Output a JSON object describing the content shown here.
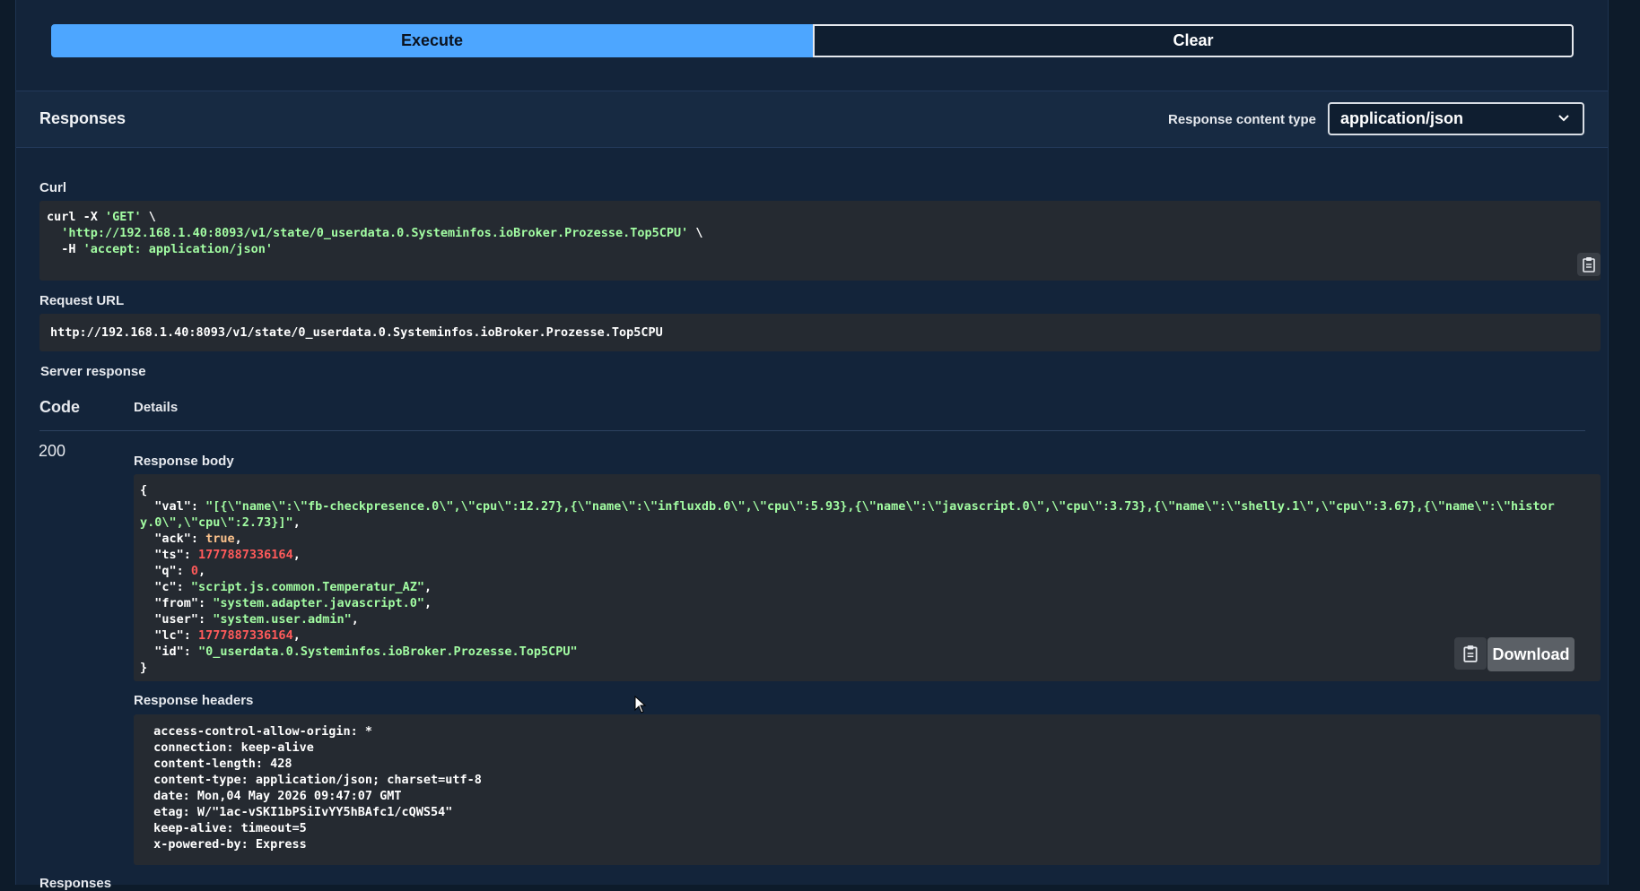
{
  "buttons": {
    "execute": "Execute",
    "clear": "Clear"
  },
  "responses_header": {
    "title": "Responses",
    "content_type_label": "Response content type",
    "content_type_value": "application/json"
  },
  "curl": {
    "label": "Curl",
    "line1_cmd": "curl -X ",
    "line1_method": "'GET'",
    "line1_end": " \\",
    "line2_indent": "  ",
    "line2_url": "'http://192.168.1.40:8093/v1/state/0_userdata.0.Systeminfos.ioBroker.Prozesse.Top5CPU'",
    "line2_end": " \\",
    "line3_flag": "  -H ",
    "line3_header": "'accept: application/json'"
  },
  "request_url": {
    "label": "Request URL",
    "value": "http://192.168.1.40:8093/v1/state/0_userdata.0.Systeminfos.ioBroker.Prozesse.Top5CPU"
  },
  "server_response": {
    "label": "Server response",
    "col_code": "Code",
    "col_details": "Details",
    "code": "200"
  },
  "response_body": {
    "label": "Response body",
    "open": "{",
    "close": "}",
    "lines": [
      {
        "key": "  \"val\": ",
        "value": "\"[{\\\"name\\\":\\\"fb-checkpresence.0\\\",\\\"cpu\\\":12.27},{\\\"name\\\":\\\"influxdb.0\\\",\\\"cpu\\\":5.93},{\\\"name\\\":\\\"javascript.0\\\",\\\"cpu\\\":3.73},{\\\"name\\\":\\\"shelly.1\\\",\\\"cpu\\\":3.67},{\\\"name\\\":\\\"histor",
        "type": "str",
        "end": ""
      },
      {
        "key": "",
        "value": "y.0\\\",\\\"cpu\\\":2.73}]\"",
        "type": "str",
        "end": ","
      },
      {
        "key": "  \"ack\": ",
        "value": "true",
        "type": "bool",
        "end": ","
      },
      {
        "key": "  \"ts\": ",
        "value": "1777887336164",
        "type": "num",
        "end": ","
      },
      {
        "key": "  \"q\": ",
        "value": "0",
        "type": "num",
        "end": ","
      },
      {
        "key": "  \"c\": ",
        "value": "\"script.js.common.Temperatur_AZ\"",
        "type": "str",
        "end": ","
      },
      {
        "key": "  \"from\": ",
        "value": "\"system.adapter.javascript.0\"",
        "type": "str",
        "end": ","
      },
      {
        "key": "  \"user\": ",
        "value": "\"system.user.admin\"",
        "type": "str",
        "end": ","
      },
      {
        "key": "  \"lc\": ",
        "value": "1777887336164",
        "type": "num",
        "end": ","
      },
      {
        "key": "  \"id\": ",
        "value": "\"0_userdata.0.Systeminfos.ioBroker.Prozesse.Top5CPU\"",
        "type": "str",
        "end": ""
      }
    ],
    "download_label": "Download"
  },
  "response_headers": {
    "label": "Response headers",
    "lines": [
      " access-control-allow-origin: * ",
      " connection: keep-alive ",
      " content-length: 428 ",
      " content-type: application/json; charset=utf-8 ",
      " date: Mon,04 May 2026 09:47:07 GMT ",
      " etag: W/\"1ac-vSKI1bPSiIvYY5hBAfc1/cQWS54\" ",
      " keep-alive: timeout=5 ",
      " x-powered-by: Express "
    ]
  },
  "footer": {
    "responses_label": "Responses"
  }
}
